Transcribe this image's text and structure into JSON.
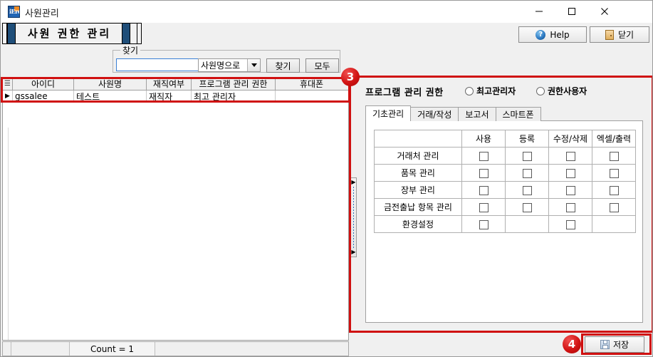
{
  "window": {
    "title": "사원관리",
    "app_icon_text": "iErc",
    "controls": {
      "minimize": "minimize-icon",
      "maximize": "maximize-icon",
      "close": "close-icon"
    }
  },
  "banner": {
    "title": "사원 권한 관리"
  },
  "toolbar": {
    "help_label": "Help",
    "help_icon": "question-circle-icon",
    "close_label": "닫기",
    "close_icon": "door-exit-icon"
  },
  "search": {
    "group_legend": "찾기",
    "input_value": "",
    "input_placeholder": "",
    "select_value": "사원명으로",
    "select_options": [
      "사원명으로"
    ],
    "find_button": "찾기",
    "all_button": "모두"
  },
  "grid": {
    "corner_icon": "grid-corner-icon",
    "columns": [
      "아이디",
      "사원명",
      "재직여부",
      "프로그램 관리 권한",
      "휴대폰"
    ],
    "rows": [
      {
        "marker": "▶",
        "cells": [
          "gssalee",
          "테스트",
          "재직자",
          "최고 관리자",
          ""
        ]
      }
    ]
  },
  "status_bar": {
    "pane1": "",
    "pane2": "",
    "count_text": "Count = 1",
    "pane4": ""
  },
  "splitter": {
    "arrow_top": "▶",
    "arrow_bottom": "▶"
  },
  "permissions": {
    "header": "프로그램 관리 권한",
    "radios": [
      {
        "label": "최고관리자",
        "checked": false
      },
      {
        "label": "권한사용자",
        "checked": false
      }
    ],
    "tabs": [
      {
        "label": "기초관리",
        "active": true
      },
      {
        "label": "거래/작성",
        "active": false
      },
      {
        "label": "보고서",
        "active": false
      },
      {
        "label": "스마트폰",
        "active": false
      }
    ],
    "table": {
      "corner": "",
      "columns": [
        "사용",
        "등록",
        "수정/삭제",
        "엑셀/출력"
      ],
      "rows": [
        {
          "label": "거래처 관리",
          "checks": [
            true,
            true,
            true,
            true
          ],
          "values": [
            false,
            false,
            false,
            false
          ]
        },
        {
          "label": "품목 관리",
          "checks": [
            true,
            true,
            true,
            true
          ],
          "values": [
            false,
            false,
            false,
            false
          ]
        },
        {
          "label": "장부 관리",
          "checks": [
            true,
            true,
            true,
            true
          ],
          "values": [
            false,
            false,
            false,
            false
          ]
        },
        {
          "label": "금전출납 항목 관리",
          "checks": [
            true,
            true,
            true,
            true
          ],
          "values": [
            false,
            false,
            false,
            false
          ]
        },
        {
          "label": "환경설정",
          "checks": [
            true,
            false,
            true,
            false
          ],
          "values": [
            false,
            false,
            false,
            false
          ]
        }
      ]
    }
  },
  "footer": {
    "save_label": "저장",
    "save_icon": "floppy-disk-icon"
  },
  "annotations": {
    "badge_3": "3",
    "badge_4": "4",
    "color": "#d01010"
  }
}
